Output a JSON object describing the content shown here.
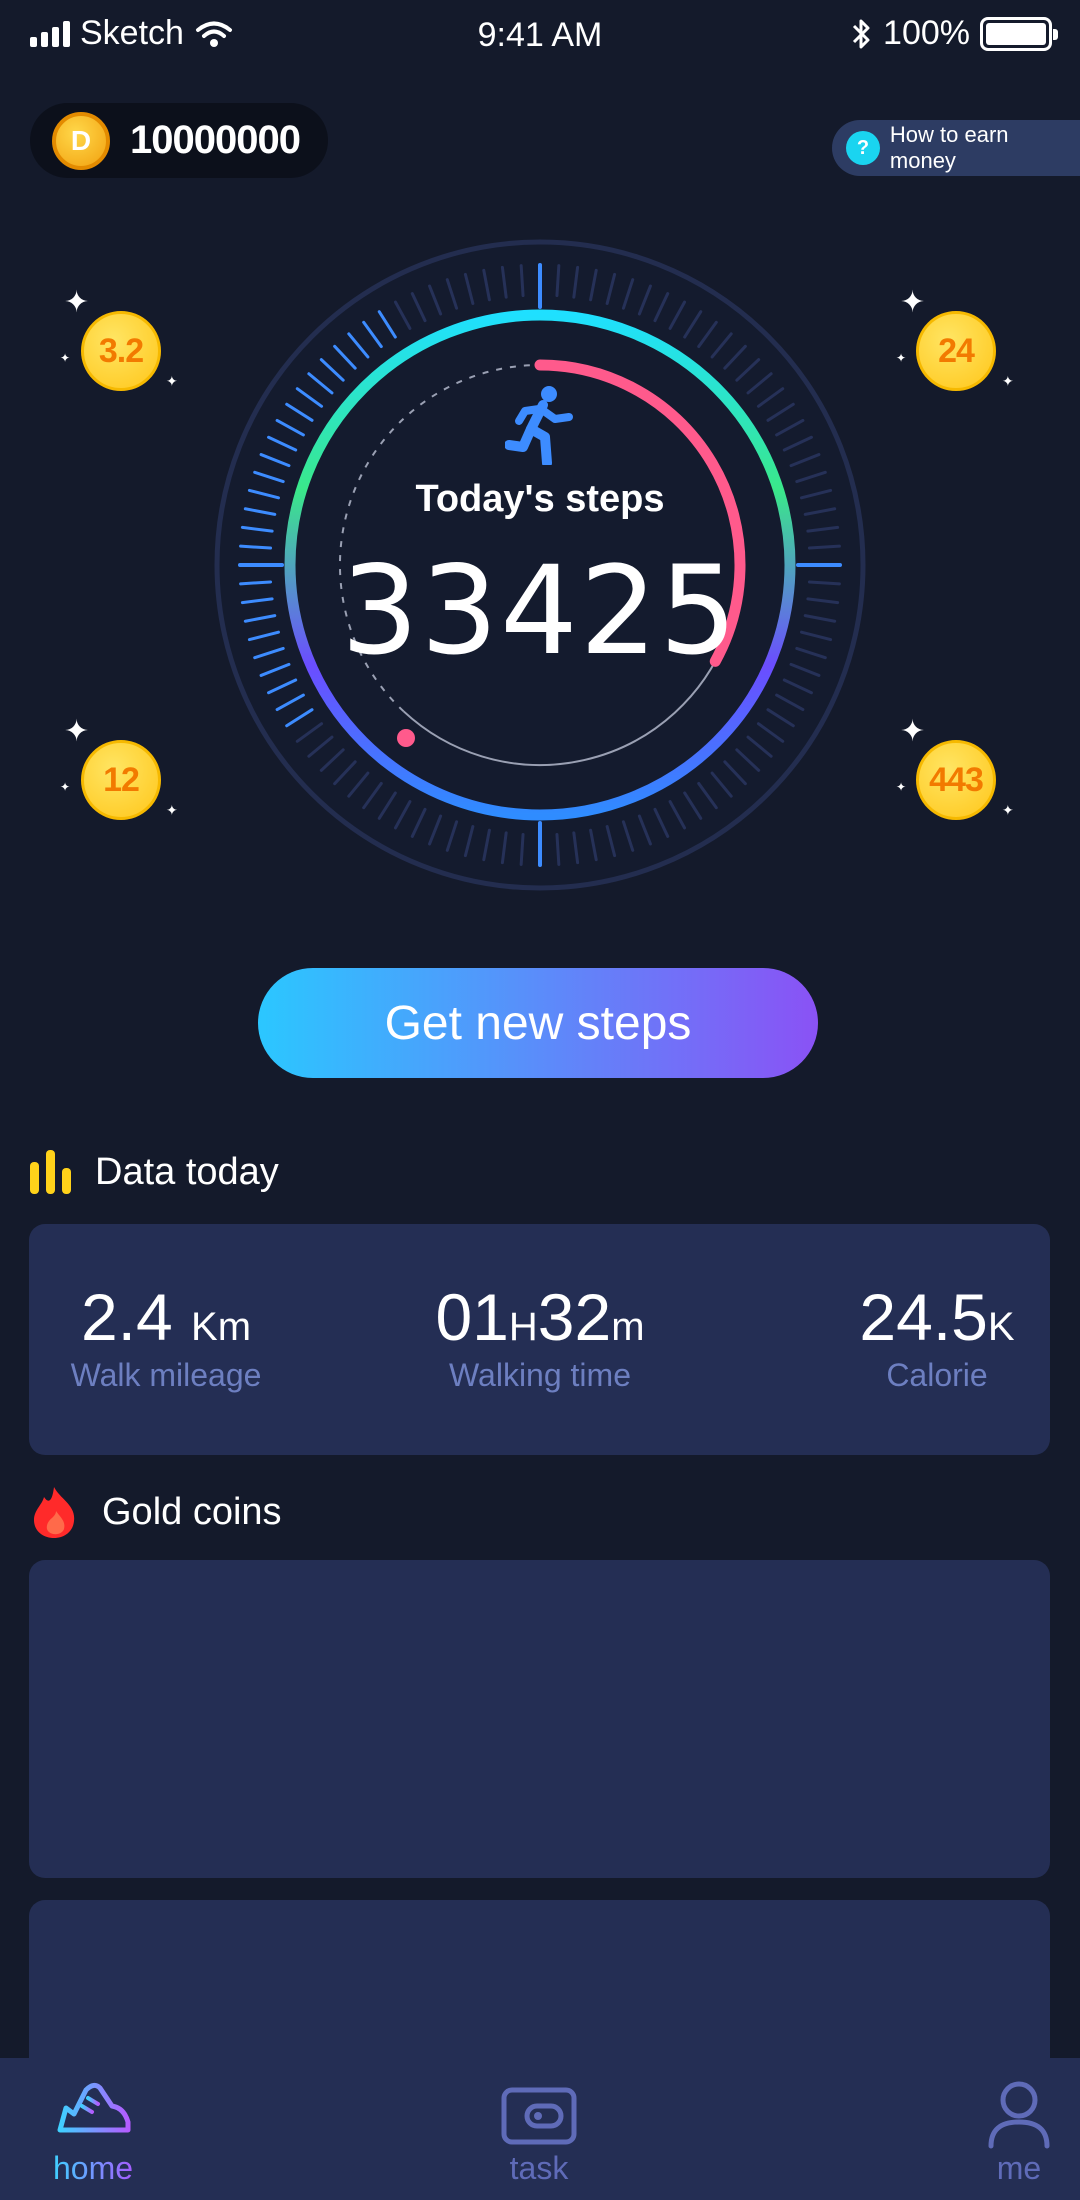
{
  "status_bar": {
    "carrier": "Sketch",
    "time": "9:41 AM",
    "battery": "100%"
  },
  "header": {
    "coin_symbol": "D",
    "coin_balance": "10000000",
    "earn_help_icon": "?",
    "earn_link": "How to earn money"
  },
  "dial": {
    "label": "Today's steps",
    "steps": "33425",
    "progress": 0.33
  },
  "floating_coins": [
    "3.2",
    "24",
    "12",
    "443"
  ],
  "get_steps_button": "Get new steps",
  "data_today": {
    "title": "Data today",
    "stats": [
      {
        "value": "2.4",
        "unit": "Km",
        "label": "Walk mileage"
      },
      {
        "hours": "01",
        "h_unit": "H",
        "minutes": "32",
        "m_unit": "m",
        "label": "Walking time"
      },
      {
        "value": "24.5",
        "unit": "K",
        "label": "Calorie"
      }
    ]
  },
  "gold_coins": {
    "title": "Gold coins"
  },
  "tabbar": {
    "tabs": [
      {
        "label": "home"
      },
      {
        "label": "task"
      },
      {
        "label": "me"
      }
    ]
  },
  "colors": {
    "background": "#141a2b",
    "card": "#242e54",
    "accent_pink": "#ff5a8c",
    "gold": "#ffc61a"
  }
}
